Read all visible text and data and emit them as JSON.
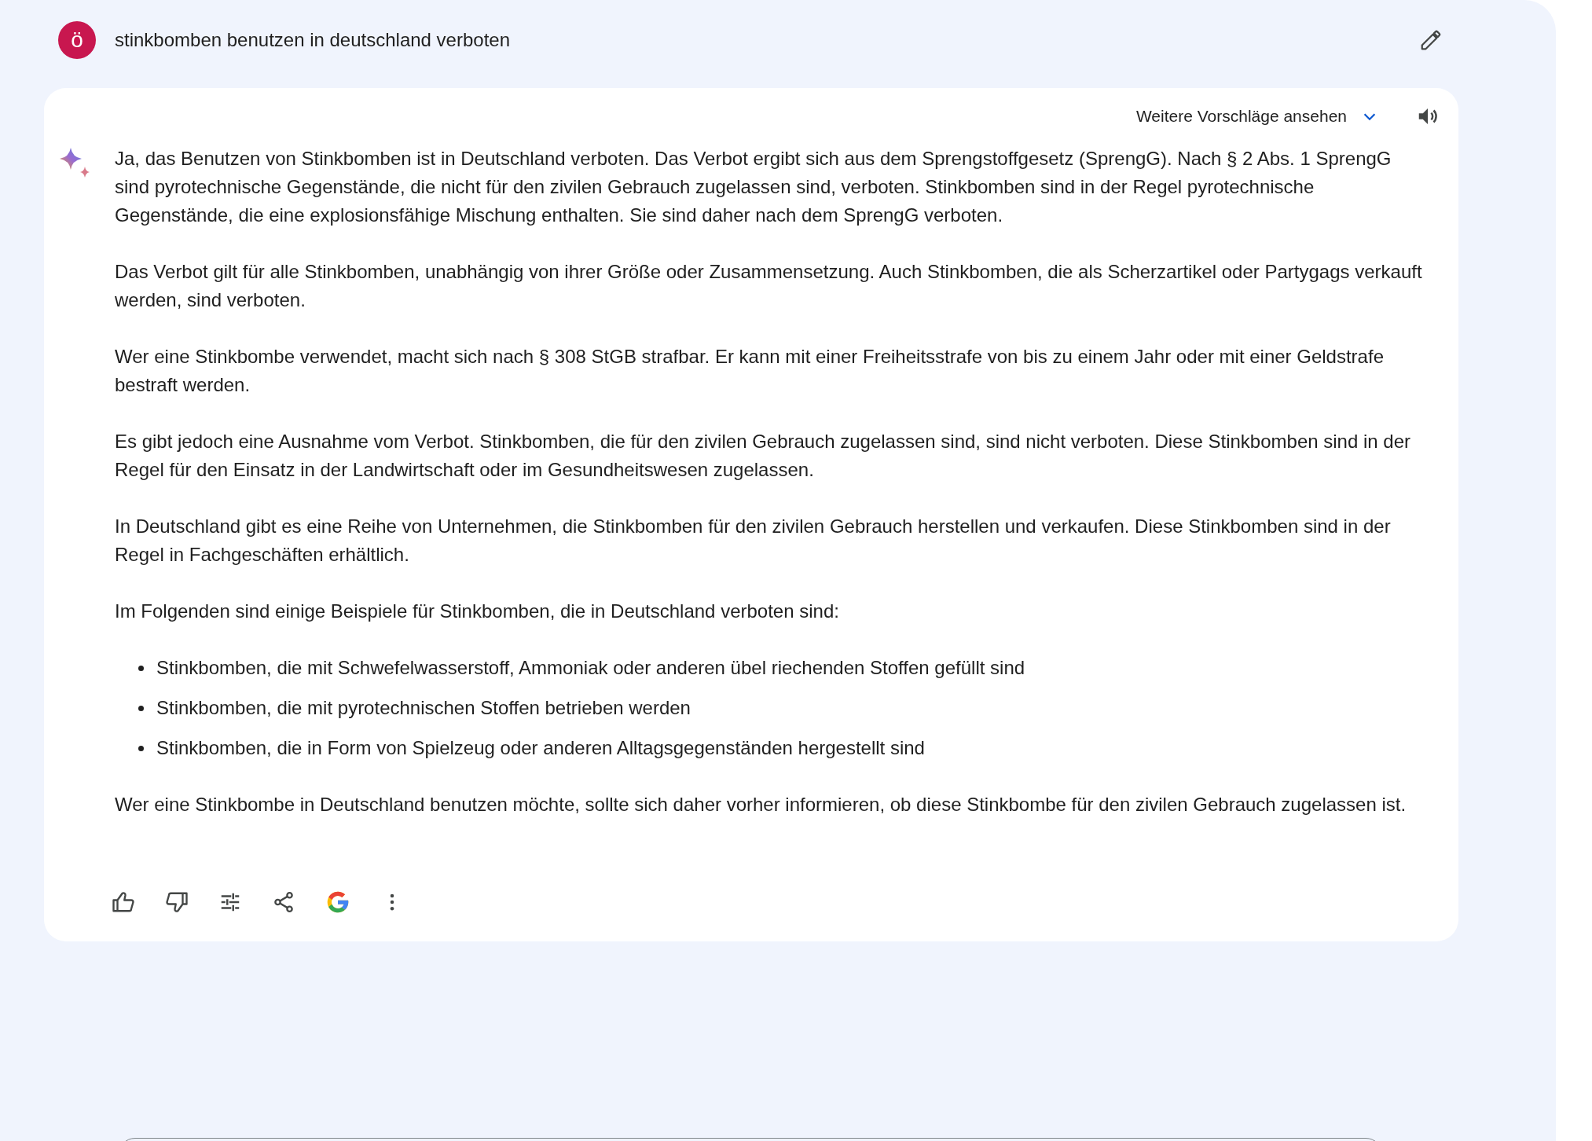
{
  "query": {
    "avatar": "ö",
    "text": "stinkbomben benutzen in deutschland verboten"
  },
  "response": {
    "more_drafts": "Weitere Vorschläge ansehen",
    "blocks": [
      {
        "kind": "paragraph",
        "text": "Ja, das Benutzen von Stinkbomben ist in Deutschland verboten. Das Verbot ergibt sich aus dem Sprengstoffgesetz (SprengG). Nach § 2 Abs. 1 SprengG sind pyrotechnische Gegenstände, die nicht für den zivilen Gebrauch zugelassen sind, verboten. Stinkbomben sind in der Regel pyrotechnische Gegenstände, die eine explosionsfähige Mischung enthalten. Sie sind daher nach dem SprengG verboten."
      },
      {
        "kind": "paragraph",
        "text": "Das Verbot gilt für alle Stinkbomben, unabhängig von ihrer Größe oder Zusammensetzung. Auch Stinkbomben, die als Scherzartikel oder Partygags verkauft werden, sind verboten."
      },
      {
        "kind": "paragraph",
        "text": "Wer eine Stinkbombe verwendet, macht sich nach § 308 StGB strafbar. Er kann mit einer Freiheitsstrafe von bis zu einem Jahr oder mit einer Geldstrafe bestraft werden."
      },
      {
        "kind": "paragraph",
        "text": "Es gibt jedoch eine Ausnahme vom Verbot. Stinkbomben, die für den zivilen Gebrauch zugelassen sind, sind nicht verboten. Diese Stinkbomben sind in der Regel für den Einsatz in der Landwirtschaft oder im Gesundheitswesen zugelassen."
      },
      {
        "kind": "paragraph",
        "text": "In Deutschland gibt es eine Reihe von Unternehmen, die Stinkbomben für den zivilen Gebrauch herstellen und verkaufen. Diese Stinkbomben sind in der Regel in Fachgeschäften erhältlich."
      },
      {
        "kind": "paragraph",
        "text": "Im Folgenden sind einige Beispiele für Stinkbomben, die in Deutschland verboten sind:"
      },
      {
        "kind": "list",
        "items": [
          "Stinkbomben, die mit Schwefelwasserstoff, Ammoniak oder anderen übel riechenden Stoffen gefüllt sind",
          "Stinkbomben, die mit pyrotechnischen Stoffen betrieben werden",
          "Stinkbomben, die in Form von Spielzeug oder anderen Alltagsgegenständen hergestellt sind"
        ]
      },
      {
        "kind": "paragraph",
        "text": "Wer eine Stinkbombe in Deutschland benutzen möchte, sollte sich daher vorher informieren, ob diese Stinkbombe für den zivilen Gebrauch zugelassen ist."
      }
    ]
  }
}
